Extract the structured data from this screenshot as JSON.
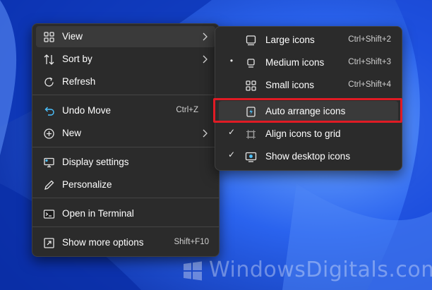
{
  "colors": {
    "menu_bg": "#2b2b2b",
    "hover_bg": "#3a3a3a",
    "accent_red": "#e01b24",
    "wallpaper": "#1f4fd6"
  },
  "context_menu": {
    "items": [
      {
        "label": "View",
        "icon": "grid-icon",
        "submenu": true
      },
      {
        "label": "Sort by",
        "icon": "sort-icon",
        "submenu": true
      },
      {
        "label": "Refresh",
        "icon": "refresh-icon"
      },
      {
        "label": "Undo Move",
        "icon": "undo-icon",
        "shortcut": "Ctrl+Z"
      },
      {
        "label": "New",
        "icon": "plus-circle-icon",
        "submenu": true
      },
      {
        "label": "Display settings",
        "icon": "display-icon"
      },
      {
        "label": "Personalize",
        "icon": "pen-icon"
      },
      {
        "label": "Open in Terminal",
        "icon": "terminal-icon"
      },
      {
        "label": "Show more options",
        "icon": "show-more-icon",
        "shortcut": "Shift+F10"
      }
    ]
  },
  "view_submenu": {
    "items": [
      {
        "label": "Large icons",
        "shortcut": "Ctrl+Shift+2",
        "icon": "large-icons-icon",
        "mark": ""
      },
      {
        "label": "Medium icons",
        "shortcut": "Ctrl+Shift+3",
        "icon": "medium-icons-icon",
        "mark": "•"
      },
      {
        "label": "Small icons",
        "shortcut": "Ctrl+Shift+4",
        "icon": "small-icons-icon",
        "mark": ""
      },
      {
        "label": "Auto arrange icons",
        "icon": "auto-arrange-icon",
        "mark": ""
      },
      {
        "label": "Align icons to grid",
        "icon": "align-grid-icon",
        "mark": "✓"
      },
      {
        "label": "Show desktop icons",
        "icon": "show-desktop-icon",
        "mark": "✓"
      }
    ]
  },
  "watermark": {
    "text": "WindowsDigitals.com"
  }
}
